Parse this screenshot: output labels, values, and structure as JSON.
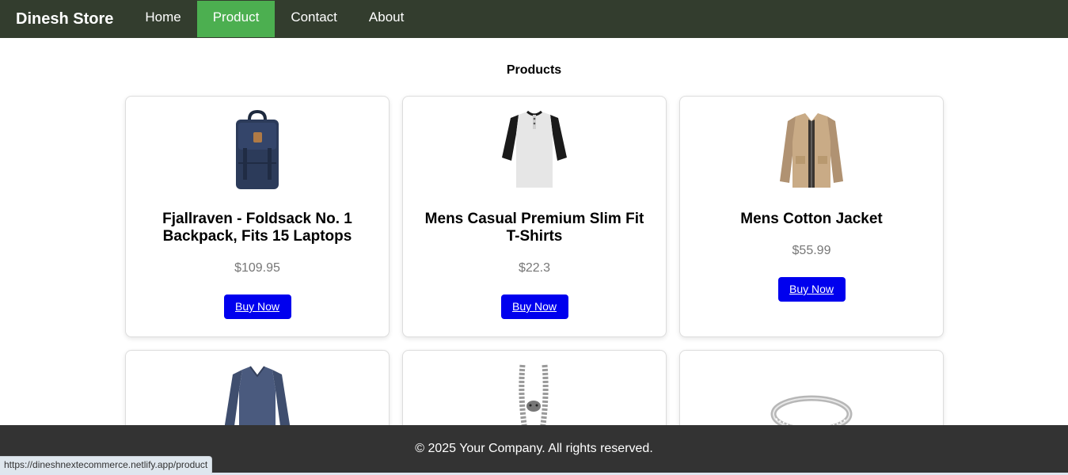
{
  "navbar": {
    "brand": "Dinesh Store",
    "items": [
      {
        "label": "Home"
      },
      {
        "label": "Product"
      },
      {
        "label": "Contact"
      },
      {
        "label": "About"
      }
    ]
  },
  "page": {
    "title": "Products"
  },
  "products": [
    {
      "title": "Fjallraven - Foldsack No. 1 Backpack, Fits 15 Laptops",
      "price": "$109.95",
      "button": "Buy Now",
      "image": "backpack"
    },
    {
      "title": "Mens Casual Premium Slim Fit T-Shirts",
      "price": "$22.3",
      "button": "Buy Now",
      "image": "henley-tshirt"
    },
    {
      "title": "Mens Cotton Jacket",
      "price": "$55.99",
      "button": "Buy Now",
      "image": "cotton-jacket"
    },
    {
      "image": "long-sleeve-shirt"
    },
    {
      "image": "dragon-bracelet"
    },
    {
      "image": "silver-ring"
    }
  ],
  "footer": {
    "text": "© 2025 Your Company. All rights reserved."
  },
  "status_bar": {
    "url": "https://dineshnextecommerce.netlify.app/product"
  },
  "colors": {
    "navbar": "#333d2e",
    "active_tab": "#4caf50",
    "button": "#0000ee",
    "footer": "#333333"
  }
}
